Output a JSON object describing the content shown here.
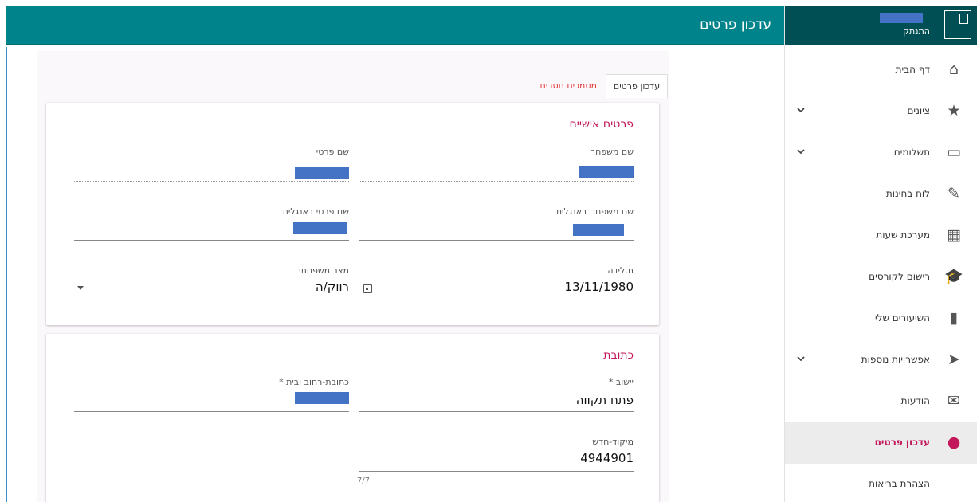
{
  "header": {
    "title": "עדכון פרטים"
  },
  "user": {
    "logout_label": "התנתק"
  },
  "sidebar": {
    "items": [
      {
        "label": "דף הבית",
        "icon": "home-icon",
        "glyph": "⌂",
        "expandable": false
      },
      {
        "label": "ציונים",
        "icon": "star-icon",
        "glyph": "★",
        "expandable": true
      },
      {
        "label": "תשלומים",
        "icon": "credit-card-icon",
        "glyph": "▭",
        "expandable": true
      },
      {
        "label": "לוח בחינות",
        "icon": "edit-icon",
        "glyph": "✎",
        "expandable": false
      },
      {
        "label": "מערכת שעות",
        "icon": "calendar-icon",
        "glyph": "▦",
        "expandable": false
      },
      {
        "label": "רישום לקורסים",
        "icon": "graduation-cap-icon",
        "glyph": "🎓",
        "expandable": false
      },
      {
        "label": "השיעורים שלי",
        "icon": "book-icon",
        "glyph": "▮",
        "expandable": false
      },
      {
        "label": "אפשרויות נוספות",
        "icon": "paper-plane-icon",
        "glyph": "➤",
        "expandable": true
      },
      {
        "label": "הודעות",
        "icon": "envelope-icon",
        "glyph": "✉",
        "expandable": false
      },
      {
        "label": "עדכון פרטים",
        "icon": "user-icon",
        "glyph": "●",
        "expandable": false,
        "active": true
      },
      {
        "label": "הצהרת בריאות",
        "icon": "",
        "glyph": "",
        "expandable": false
      }
    ]
  },
  "tabs": {
    "active": "עדכון פרטים",
    "missing_docs": "מסמכים חסרים"
  },
  "personal": {
    "title": "פרטים אישיים",
    "last_name_label": "שם משפחה",
    "first_name_label": "שם פרטי",
    "last_name_en_label": "שם משפחה באנגלית",
    "first_name_en_label": "שם פרטי באנגלית",
    "birth_date_label": "ת.לידה",
    "birth_date": "13/11/1980",
    "marital_label": "מצב משפחתי",
    "marital_value": "רווק/ה"
  },
  "address": {
    "title": "כתובת",
    "city_label": "יישוב *",
    "city_value": "פתח תקווה",
    "street_label": "כתובת-רחוב ובית *",
    "zip_label": "מיקוד-חדש",
    "zip_value": "4944901",
    "zip_counter": "7/7"
  },
  "colors": {
    "header": "#00838a",
    "sidebar_header": "#004f55",
    "accent": "#c2185b",
    "redaction": "#4472c4"
  }
}
